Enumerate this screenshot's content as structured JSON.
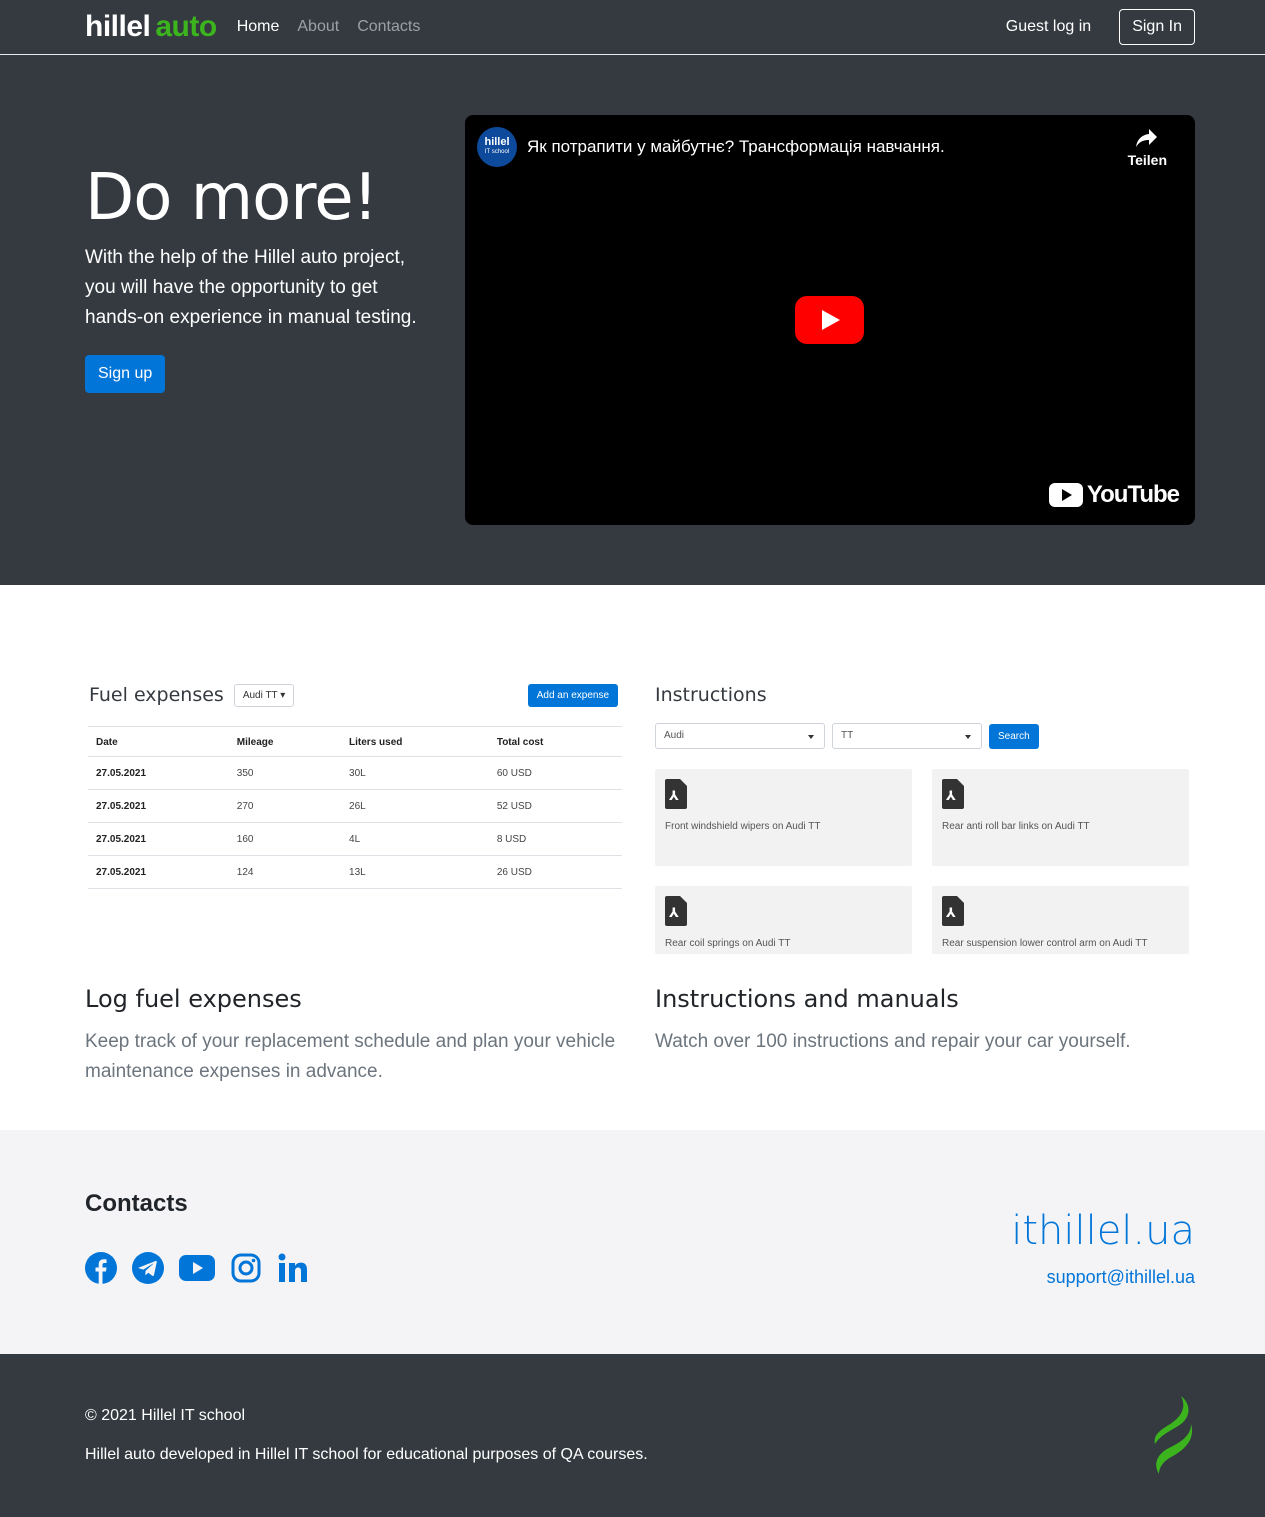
{
  "header": {
    "logo_main": "hillel",
    "logo_accent": "auto",
    "nav": [
      {
        "label": "Home"
      },
      {
        "label": "About"
      },
      {
        "label": "Contacts"
      }
    ],
    "guest_login": "Guest log in",
    "signin": "Sign In"
  },
  "hero": {
    "title": "Do more!",
    "description": "With the help of the Hillel auto project, you will have the opportunity to get hands-on experience in manual testing.",
    "signup": "Sign up",
    "video": {
      "channel_name": "hillel",
      "channel_sub": "IT school",
      "title": "Як потрапити у майбутнє? Трансформація навчання.",
      "share": "Teilen",
      "brand": "YouTube"
    }
  },
  "fuel_preview": {
    "title": "Fuel expenses",
    "car": "Audi TT",
    "add_button": "Add an expense",
    "columns": [
      "Date",
      "Mileage",
      "Liters used",
      "Total cost"
    ],
    "rows": [
      [
        "27.05.2021",
        "350",
        "30L",
        "60 USD"
      ],
      [
        "27.05.2021",
        "270",
        "26L",
        "52 USD"
      ],
      [
        "27.05.2021",
        "160",
        "4L",
        "8 USD"
      ],
      [
        "27.05.2021",
        "124",
        "13L",
        "26 USD"
      ]
    ]
  },
  "instructions_preview": {
    "title": "Instructions",
    "brand_select": "Audi",
    "model_select": "TT",
    "search": "Search",
    "cards": [
      "Front windshield wipers on Audi TT",
      "Rear anti roll bar links on Audi TT",
      "Rear coil springs on Audi TT",
      "Rear suspension lower control arm on Audi TT"
    ]
  },
  "features": {
    "fuel": {
      "heading": "Log fuel expenses",
      "text": "Keep track of your replacement schedule and plan your vehicle maintenance expenses in advance."
    },
    "instructions": {
      "heading": "Instructions and manuals",
      "text": "Watch over 100 instructions and repair your car yourself."
    }
  },
  "contacts": {
    "title": "Contacts",
    "socials": [
      "facebook-icon",
      "telegram-icon",
      "youtube-icon",
      "instagram-icon",
      "linkedin-icon"
    ],
    "site": "ithillel.ua",
    "email": "support@ithillel.ua",
    "accent_color": "#0275d8"
  },
  "footer": {
    "copyright": "© 2021 Hillel IT school",
    "note": "Hillel auto developed in Hillel IT school for educational purposes of QA courses."
  }
}
